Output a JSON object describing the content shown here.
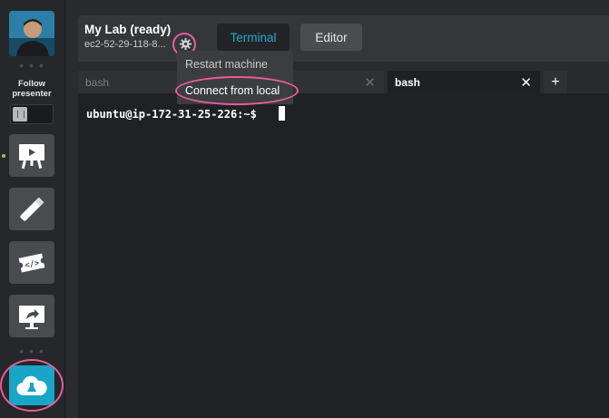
{
  "sidebar": {
    "follow_label": "Follow\npresenter",
    "buttons": [
      {
        "icon": "presentation-board-icon"
      },
      {
        "icon": "laser-pointer-icon"
      },
      {
        "icon": "code-ticket-icon"
      },
      {
        "icon": "screen-share-icon"
      }
    ],
    "lab_icon": "cloud-lab-icon"
  },
  "header": {
    "lab_title": "My Lab (ready)",
    "host": "ec2-52-29-118-8...",
    "tabs": [
      {
        "label": "Terminal",
        "active": true
      },
      {
        "label": "Editor",
        "active": false
      }
    ]
  },
  "menu": {
    "items": [
      {
        "label": "Restart machine"
      },
      {
        "label": "Connect from local"
      }
    ]
  },
  "terminal": {
    "tabs": [
      {
        "label": "bash",
        "active": false
      },
      {
        "label": "bash",
        "active": true
      }
    ],
    "add_label": "+",
    "close_glyph": "✕",
    "prompt": "ubuntu@ip-172-31-25-226:~$"
  },
  "colors": {
    "accent": "#18a5c6",
    "highlight_ring": "#e85c9c",
    "active_indicator": "#9bc53d"
  }
}
